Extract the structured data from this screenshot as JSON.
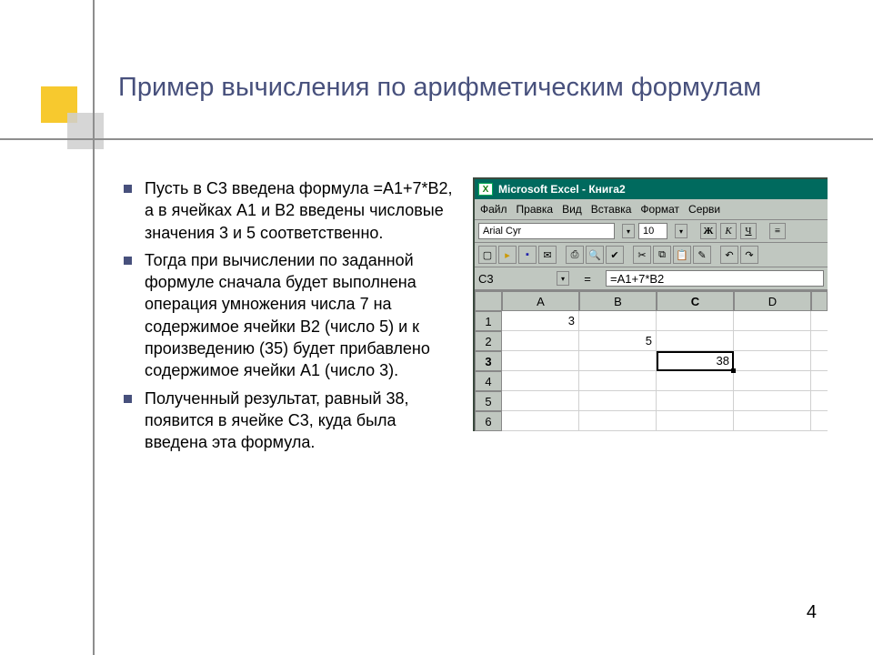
{
  "title": "Пример вычисления по арифметическим формулам",
  "bullets": [
    "Пусть в С3 введена формула =А1+7*В2, а в ячейках А1 и В2 введены числовые значения 3 и 5 соответственно.",
    "Тогда при вычислении по заданной формуле сначала будет выполнена операция умножения числа 7 на содержимое ячейки В2 (число 5) и к произведению (35) будет прибавлено содержимое ячейки А1 (число 3).",
    "Полученный результат, равный 38, появится в ячейке С3, куда была введена эта формула."
  ],
  "page_num": "4",
  "excel": {
    "win_title": "Microsoft Excel - Книга2",
    "menu": [
      "Файл",
      "Правка",
      "Вид",
      "Вставка",
      "Формат",
      "Серви"
    ],
    "font_name": "Arial Cyr",
    "font_size": "10",
    "fmt": {
      "bold": "Ж",
      "italic": "К",
      "underline": "Ч"
    },
    "name_box": "C3",
    "formula": "=A1+7*B2",
    "cols": [
      "A",
      "B",
      "C",
      "D"
    ],
    "rows": [
      {
        "n": "1",
        "c": [
          "3",
          "",
          "",
          ""
        ],
        "active": false
      },
      {
        "n": "2",
        "c": [
          "",
          "5",
          "",
          ""
        ],
        "active": false
      },
      {
        "n": "3",
        "c": [
          "",
          "",
          "38",
          ""
        ],
        "active": true,
        "sel": 2
      },
      {
        "n": "4",
        "c": [
          "",
          "",
          "",
          ""
        ],
        "active": false
      },
      {
        "n": "5",
        "c": [
          "",
          "",
          "",
          ""
        ],
        "active": false
      },
      {
        "n": "6",
        "c": [
          "",
          "",
          "",
          ""
        ],
        "active": false
      }
    ]
  }
}
